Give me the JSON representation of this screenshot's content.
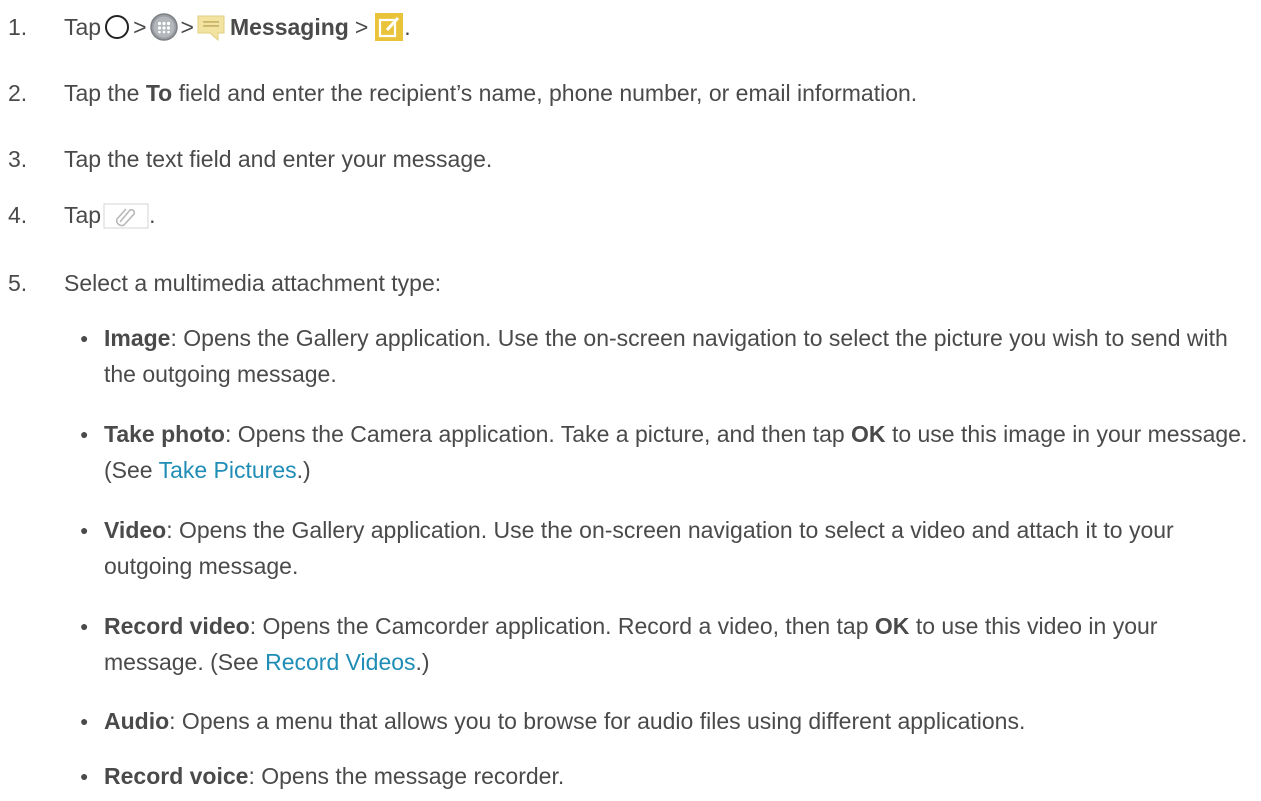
{
  "steps": {
    "s1": {
      "num": "1.",
      "tap": "Tap",
      "sep1": ">",
      "sep2": ">",
      "app": "Messaging",
      "sep3": ">",
      "end": "."
    },
    "s2": {
      "num": "2.",
      "pre": "Tap the",
      "bold": "To",
      "post": "field and enter the recipient’s name, phone number, or email information."
    },
    "s3": {
      "num": "3.",
      "text": "Tap the text field and enter your message."
    },
    "s4": {
      "num": "4.",
      "tap": "Tap",
      "end": "."
    },
    "s5": {
      "num": "5.",
      "text": "Select a multimedia attachment type:"
    }
  },
  "options": [
    {
      "label": "Image",
      "desc": ": Opens the Gallery application. Use the on-screen navigation to select the picture you wish to send with the outgoing message."
    },
    {
      "label": "Take photo",
      "desc_a": ": Opens the Camera application. Take a picture, and then tap",
      "ok": "OK",
      "desc_b": "to use this image in your message. (See",
      "link": "Take Pictures",
      "desc_c": ".)"
    },
    {
      "label": "Video",
      "desc": ": Opens the Gallery application. Use the on-screen navigation to select a video and attach it to your outgoing message."
    },
    {
      "label": "Record video",
      "desc_a": ": Opens the Camcorder application. Record a video, then tap",
      "ok": "OK",
      "desc_b": "to use this video in your message. (See",
      "link": "Record Videos",
      "desc_c": ".)"
    },
    {
      "label": "Audio",
      "desc": ": Opens a menu that allows you to browse for audio files using different applications."
    },
    {
      "label": "Record voice",
      "desc": ": Opens the message recorder."
    }
  ],
  "bullet_glyph": "●",
  "icons": {
    "home": "home-circle-icon",
    "apps": "apps-grid-icon",
    "messaging": "messaging-app-icon",
    "compose": "compose-icon",
    "attach": "paperclip-icon"
  },
  "colors": {
    "text": "#4a4a4a",
    "link": "#1f8db5",
    "messaging_icon": "#f3e3a0",
    "compose_icon": "#e9c43a"
  }
}
